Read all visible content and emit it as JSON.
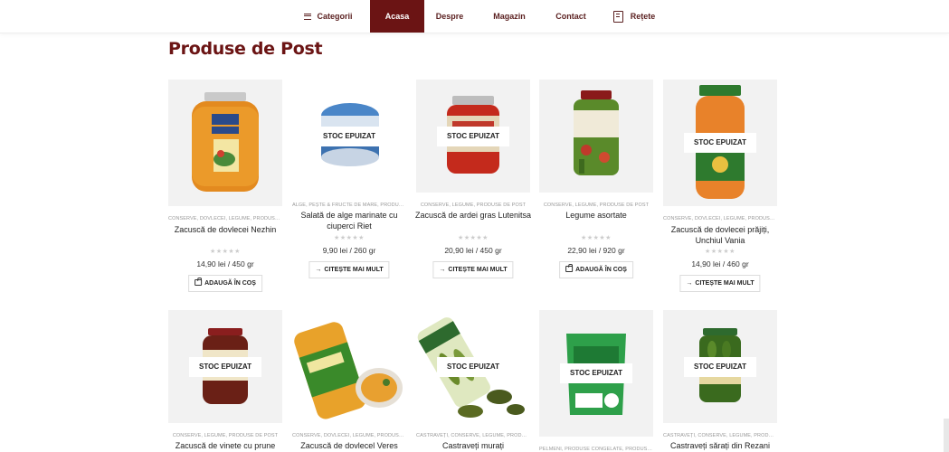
{
  "nav": {
    "items": [
      {
        "label": "Categorii",
        "icon": "menu-icon"
      },
      {
        "label": "Acasa",
        "active": true
      },
      {
        "label": "Despre"
      },
      {
        "label": "Magazin"
      },
      {
        "label": "Contact"
      },
      {
        "label": "Rețete",
        "icon": "recipe-book-icon"
      }
    ]
  },
  "section_title": "Produse de Post",
  "labels": {
    "out_of_stock": "STOC EPUIZAT",
    "read_more": "CITEȘTE MAI MULT",
    "add_to_cart": "ADAUGĂ ÎN COȘ",
    "stars": "★★★★★"
  },
  "colors": {
    "brand": "#6b1414",
    "image_bg": "#f2f2f2",
    "stars": "#cccccc"
  },
  "products": [
    {
      "categories": "CONSERVE, DOVLECEI, LEGUME, PRODUSE DE POST",
      "name": "Zacuscă de dovlecei Nezhin",
      "price": "14,90 lei / 450 gr",
      "out_of_stock": false,
      "button": "add_to_cart"
    },
    {
      "categories": "ALGE, PEȘTE & FRUCTE DE MARE, PRODUSE DE POST",
      "name": "Salată de alge marinate cu ciuperci Riet",
      "price": "9,90 lei / 260 gr",
      "out_of_stock": true,
      "button": "read_more"
    },
    {
      "categories": "CONSERVE, LEGUME, PRODUSE DE POST",
      "name": "Zacuscă de ardei gras Lutenitsa",
      "price": "20,90 lei / 450 gr",
      "out_of_stock": true,
      "button": "read_more"
    },
    {
      "categories": "CONSERVE, LEGUME, PRODUSE DE POST",
      "name": "Legume asortate",
      "price": "22,90 lei / 920 gr",
      "out_of_stock": false,
      "button": "add_to_cart"
    },
    {
      "categories": "CONSERVE, DOVLECEI, LEGUME, PRODUSE DE POST",
      "name": "Zacuscă de dovlecei prăjiți, Unchiul Vania",
      "price": "14,90 lei / 460 gr",
      "out_of_stock": true,
      "button": "read_more"
    },
    {
      "categories": "CONSERVE, LEGUME, PRODUSE DE POST",
      "name": "Zacuscă de vinete cu prune",
      "out_of_stock": true
    },
    {
      "categories": "CONSERVE, DOVLECEI, LEGUME, PRODUSE DE POST",
      "name": "Zacuscă de dovlecel Veres",
      "out_of_stock": false
    },
    {
      "categories": "CASTRAVEȚI, CONSERVE, LEGUME, PRODUSE DE POST",
      "name": "Castraveți murați",
      "out_of_stock": true
    },
    {
      "categories": "PELMENI, PRODUSE CONGELATE, PRODUSE DE POST",
      "name": "",
      "out_of_stock": true
    },
    {
      "categories": "CASTRAVEȚI, CONSERVE, LEGUME, PRODUSE DE POST",
      "name": "Castraveți sărați din Rezani",
      "out_of_stock": true
    }
  ]
}
